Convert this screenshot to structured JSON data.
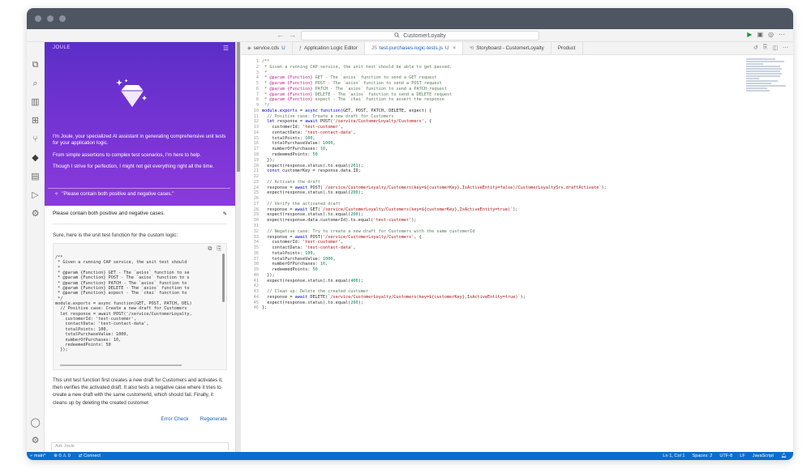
{
  "window": {
    "title_dots": 3
  },
  "topbar": {
    "back": "←",
    "forward": "→",
    "search_icon": "search-icon",
    "command_center": "CustomerLoyalty",
    "actions": [
      "run-icon",
      "layout-icon",
      "account-icon",
      "more-icon"
    ]
  },
  "activity_bar": {
    "items": [
      "explorer-icon",
      "search-icon",
      "library-icon",
      "template-icon",
      "git-icon",
      "joule-icon",
      "storyboard-icon",
      "run-debug-icon",
      "extensions-icon"
    ],
    "bottom": [
      "account-icon",
      "settings-icon"
    ]
  },
  "joule": {
    "header": "JOULE",
    "menu": "☰",
    "intro": "I'm Joule, your specialized AI assistant in generating comprehensive unit tests for your application logic.",
    "line2": "From simple assertions to complex test scenarios, I'm here to help.",
    "line3": "Though I strive for perfection, I might not get everything right all the time.",
    "prompt_chip": "\"Please contain both positive and negative cases.\"",
    "user_message": "Please contain both positive and negative cases.",
    "response_intro": "Sure, here is the unit test function for the custom logic:",
    "code_snippet": "/**\n * Given a running CAP service, the unit test should\n *\n * @param {Function} GET - The `axios` function to se\n * @param {Function} POST - The `axios` function to s\n * @param {Function} PATCH - The `axios` function to\n * @param {Function} DELETE - The `axios` function to\n * @param {Function} expect - The `chai` function to\n */\nmodule.exports = async function(GET, POST, PATCH, DEL)\n  // Positive case: Create a new draft for Customers\n  let response = await POST('/service/CustomerLoyalty,\n    customerId: 'test-customer',\n    contactData: 'test-contact-data',\n    totalPoints: 100,\n    totalPurchaseValue: 1000,\n    numberOfPurchases: 10,\n    redeemedPoints: 50\n  });",
    "response_text": "This unit test function first creates a new draft for Customers and activates it, then verifies the activated draft. It also tests a negative case where it tries to create a new draft with the same customerId, which should fail. Finally, it cleans up by deleting the created customer.",
    "error_check": "Error Check",
    "regenerate": "Regenerate",
    "ask_placeholder": "Ask Joule"
  },
  "tabs": [
    {
      "label": "service.cds",
      "suffix": "U",
      "icon": "cds-file-icon",
      "active": false
    },
    {
      "label": "Application Logic Editor",
      "suffix": "",
      "icon": "logic-editor-icon",
      "active": false
    },
    {
      "label": "test-purchases-logic-tests.js",
      "suffix": "U",
      "icon": "js-file-icon",
      "active": true
    },
    {
      "label": "Storyboard - CustomerLoyalty",
      "suffix": "",
      "icon": "storyboard-icon",
      "active": false
    },
    {
      "label": "Product",
      "suffix": "",
      "icon": "",
      "active": false
    }
  ],
  "editor": {
    "lines": [
      "/**",
      " * Given a running CAP service, the unit test should be able to get passed.",
      " *",
      " * @param {Function} GET - The `axios` function to send a GET request",
      " * @param {Function} POST - The `axios` function to send a POST request",
      " * @param {Function} PATCH - The `axios` function to send a PATCH request",
      " * @param {Function} DELETE - The `axios` function to send a DELETE request",
      " * @param {Function} expect - The `chai` function to assert the response",
      " */",
      "module.exports = async function(GET, POST, PATCH, DELETE, expect) {",
      "  // Positive case: Create a new draft for Customers",
      "  let response = await POST('/service/CustomerLoyalty/Customers', {",
      "    customerId: 'test-customer',",
      "    contactData: 'test-contact-data',",
      "    totalPoints: 100,",
      "    totalPurchaseValue: 1000,",
      "    numberOfPurchases: 10,",
      "    redeemedPoints: 50",
      "  });",
      "  expect(response.status).to.equal(201);",
      "  const customerKey = response.data.ID;",
      "",
      "  // Activate the draft",
      "  response = await POST(`/service/CustomerLoyalty/Customers(key=${customerKey},IsActiveEntity=false)/CustomerLoyaltySrv.draftActivate`);",
      "  expect(response.status).to.equal(200);",
      "",
      "  // Verify the activated draft",
      "  response = await GET(`/service/CustomerLoyalty/Customers(key=${customerKey},IsActiveEntity=true)`);",
      "  expect(response.status).to.equal(200);",
      "  expect(response.data.customerId).to.equal('test-customer');",
      "",
      "  // Negative case: Try to create a new draft for Customers with the same customerId",
      "  response = await POST('/service/CustomerLoyalty/Customers', {",
      "    customerId: 'test-customer',",
      "    contactData: 'test-contact-data',",
      "    totalPoints: 100,",
      "    totalPurchaseValue: 1000,",
      "    numberOfPurchases: 10,",
      "    redeemedPoints: 50",
      "  });",
      "  expect(response.status).to.equal(400);",
      "",
      "  // Clean up: Delete the created customer",
      "  response = await DELETE(`/service/CustomerLoyalty/Customers(key=${customerKey},IsActiveEntity=true)`);",
      "  expect(response.status).to.equal(200);",
      "};"
    ]
  },
  "statusbar": {
    "branch": "main*",
    "problems": "⊗ 0 ⚠ 0",
    "connect": "Connect",
    "position": "Ln 1, Col 1",
    "spaces": "Spaces: 2",
    "encoding": "UTF-8",
    "eol": "LF",
    "language": "JavaScript"
  },
  "colors": {
    "joule_purple": "#6a32d0",
    "statusbar_blue": "#0a6ed1",
    "link_blue": "#1a5fb4"
  }
}
